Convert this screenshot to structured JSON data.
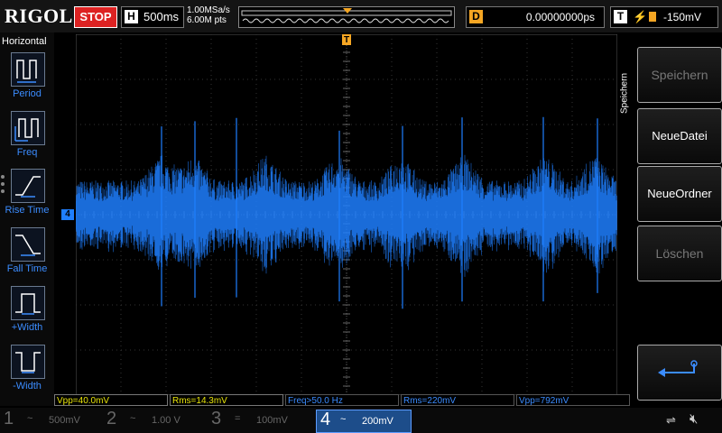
{
  "top": {
    "brand": "RIGOL",
    "run_state": "STOP",
    "horizontal_badge": "H",
    "timebase": "500ms",
    "sample_rate": "1.00MSa/s",
    "memory_depth": "6.00M pts",
    "delay_badge": "D",
    "delay": "0.00000000ps",
    "trigger_badge": "T",
    "trigger_level": "-150mV",
    "trigger_marker": "T"
  },
  "left_menu": {
    "title": "Horizontal",
    "items": [
      {
        "label": "Period",
        "icon": "period-icon"
      },
      {
        "label": "Freq",
        "icon": "frequency-icon"
      },
      {
        "label": "Rise Time",
        "icon": "rise-time-icon"
      },
      {
        "label": "Fall Time",
        "icon": "fall-time-icon"
      },
      {
        "label": "+Width",
        "icon": "positive-width-icon"
      },
      {
        "label": "-Width",
        "icon": "negative-width-icon"
      }
    ]
  },
  "channel_marker": "4",
  "right_panel": {
    "tab_label": "Speichern",
    "buttons": [
      "Speichern",
      "NeueDatei",
      "NeueOrdner",
      "Löschen"
    ],
    "enter_icon": "enter-return-icon"
  },
  "measurements": [
    {
      "text": "Vpp=40.0mV",
      "color": "#e8e40a"
    },
    {
      "text": "Rms=14.3mV",
      "color": "#e8e40a"
    },
    {
      "text": "Freq>50.0 Hz",
      "color": "#3b8cff"
    },
    {
      "text": "Rms=220mV",
      "color": "#3b8cff"
    },
    {
      "text": "Vpp=792mV",
      "color": "#3b8cff"
    }
  ],
  "channels": [
    {
      "num": "1",
      "coupling": "~",
      "scale": "500mV",
      "active": false
    },
    {
      "num": "2",
      "coupling": "~",
      "scale": "1.00 V",
      "active": false
    },
    {
      "num": "3",
      "coupling": "=",
      "scale": "100mV",
      "active": false
    },
    {
      "num": "4",
      "coupling": "~",
      "scale": "200mV",
      "active": true
    }
  ],
  "colors": {
    "trace": "#1f7fff",
    "accent_orange": "#f5a623",
    "stop_red": "#d22222",
    "measure_yellow": "#e8e40a",
    "measure_blue": "#3b8cff"
  }
}
